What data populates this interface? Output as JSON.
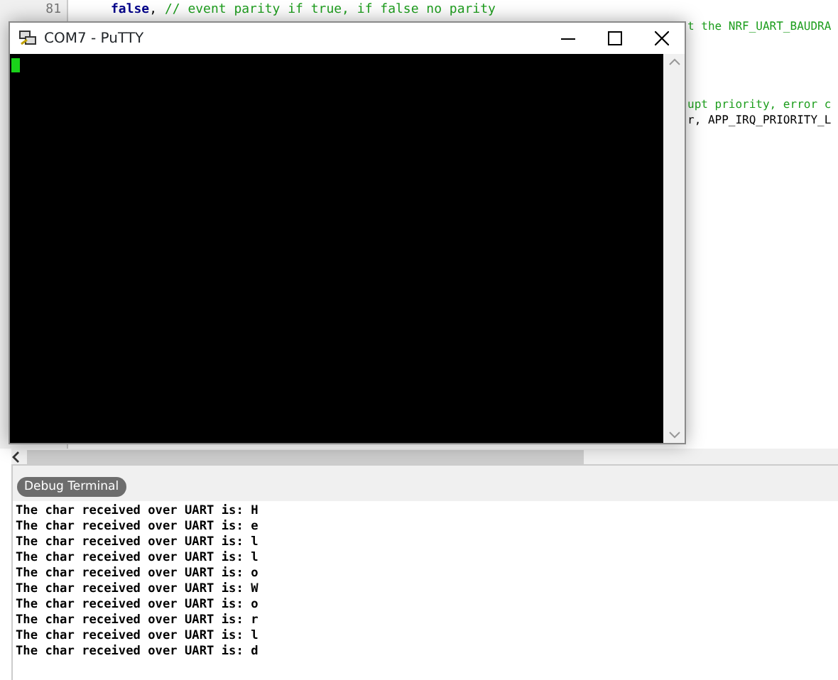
{
  "editor": {
    "lines": [
      {
        "number": "81",
        "segments": [
          {
            "kind": "keyword",
            "text": "false"
          },
          {
            "kind": "code",
            "text": ", "
          },
          {
            "kind": "comment",
            "text": "// event parity if true, if false no parity"
          }
        ]
      },
      {
        "segments": [
          {
            "kind": "comment",
            "text": "t the NRF_UART_BAUDRA"
          }
        ]
      },
      {
        "segments": [
          {
            "kind": "comment",
            "text": "upt priority, error c"
          }
        ]
      },
      {
        "segments": [
          {
            "kind": "code",
            "text": "r, APP_IRQ_PRIORITY_L"
          }
        ]
      }
    ]
  },
  "putty": {
    "title": "COM7 - PuTTY"
  },
  "debug": {
    "tab": "Debug Terminal",
    "lines": [
      "The char received over UART is: H",
      "The char received over UART is: e",
      "The char received over UART is: l",
      "The char received over UART is: l",
      "The char received over UART is: o",
      "The char received over UART is: W",
      "The char received over UART is: o",
      "The char received over UART is: r",
      "The char received over UART is: l",
      "The char received over UART is: d"
    ]
  }
}
